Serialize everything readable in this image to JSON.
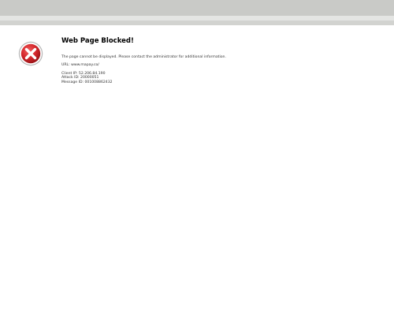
{
  "page": {
    "title": "Web Page Blocked!",
    "message": "The page cannot be displayed. Please contact the administrator for additional information.",
    "url_line": "URL: www.mapay.co/",
    "client_ip_line": "Client IP: 52.206.84.190",
    "attack_id_line": "Attack ID: 20000051",
    "message_id_line": "Message ID: 001008862432"
  },
  "icon": {
    "name": "error-icon",
    "color": "#cf1f25"
  }
}
